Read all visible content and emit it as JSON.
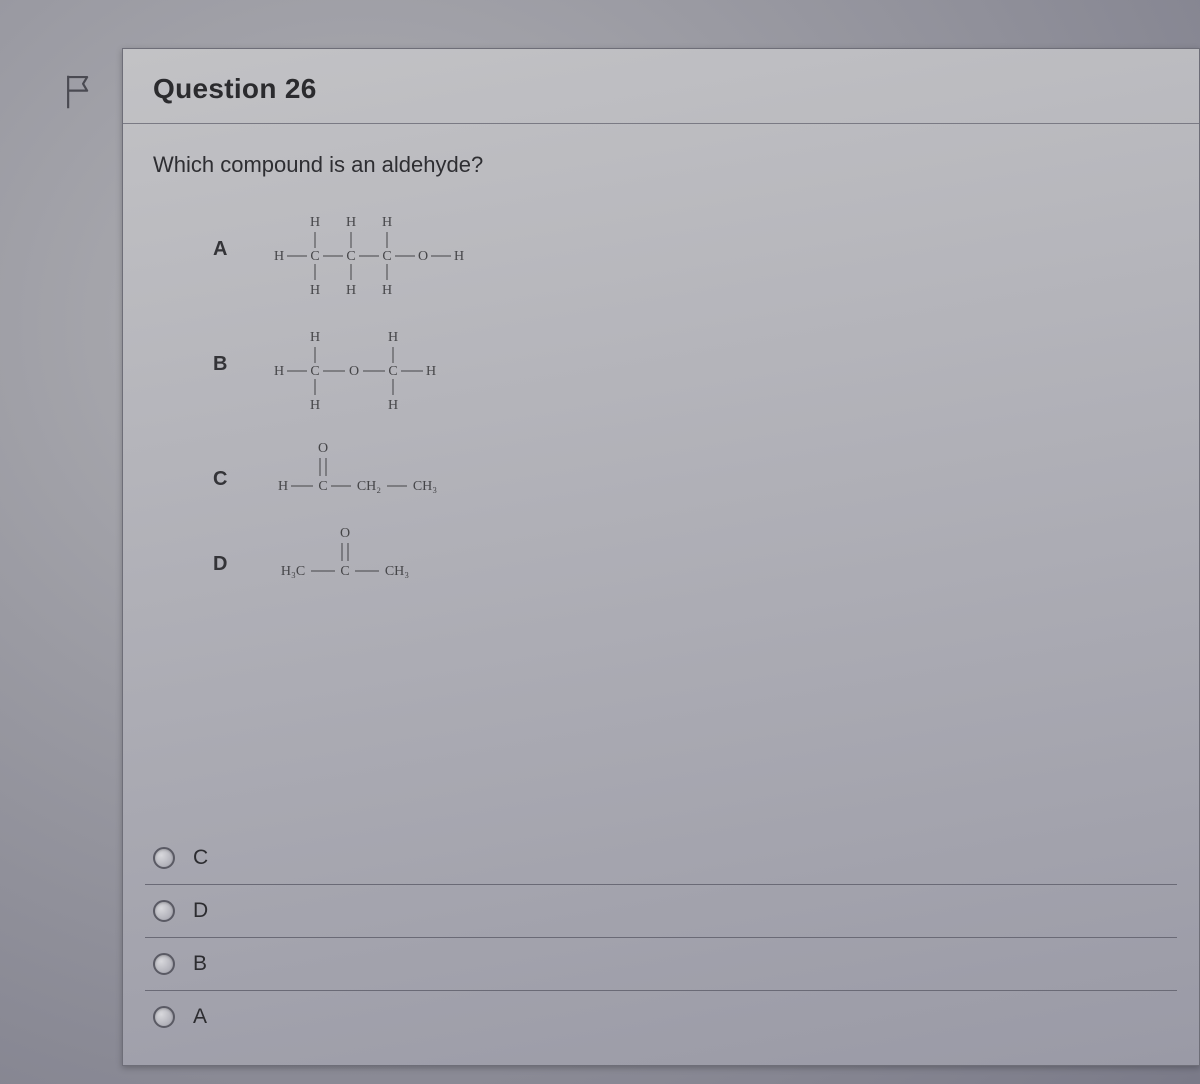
{
  "question": {
    "title": "Question 26",
    "text": "Which compound is an aldehyde?",
    "structures": [
      {
        "label": "A",
        "formula": "H-CH2-CH2-CH2-O-H (propanol, expanded structure)"
      },
      {
        "label": "B",
        "formula": "H-CH2-O-CH2-H (dimethyl ether, expanded structure)"
      },
      {
        "label": "C",
        "formula": "H-C(=O)-CH2-CH3 (propanal)"
      },
      {
        "label": "D",
        "formula": "H3C-C(=O)-CH3 (propanone)"
      }
    ]
  },
  "answers": [
    {
      "label": "C",
      "selected": false
    },
    {
      "label": "D",
      "selected": false
    },
    {
      "label": "B",
      "selected": false
    },
    {
      "label": "A",
      "selected": false
    }
  ],
  "icons": {
    "flag": "flag-outline"
  }
}
